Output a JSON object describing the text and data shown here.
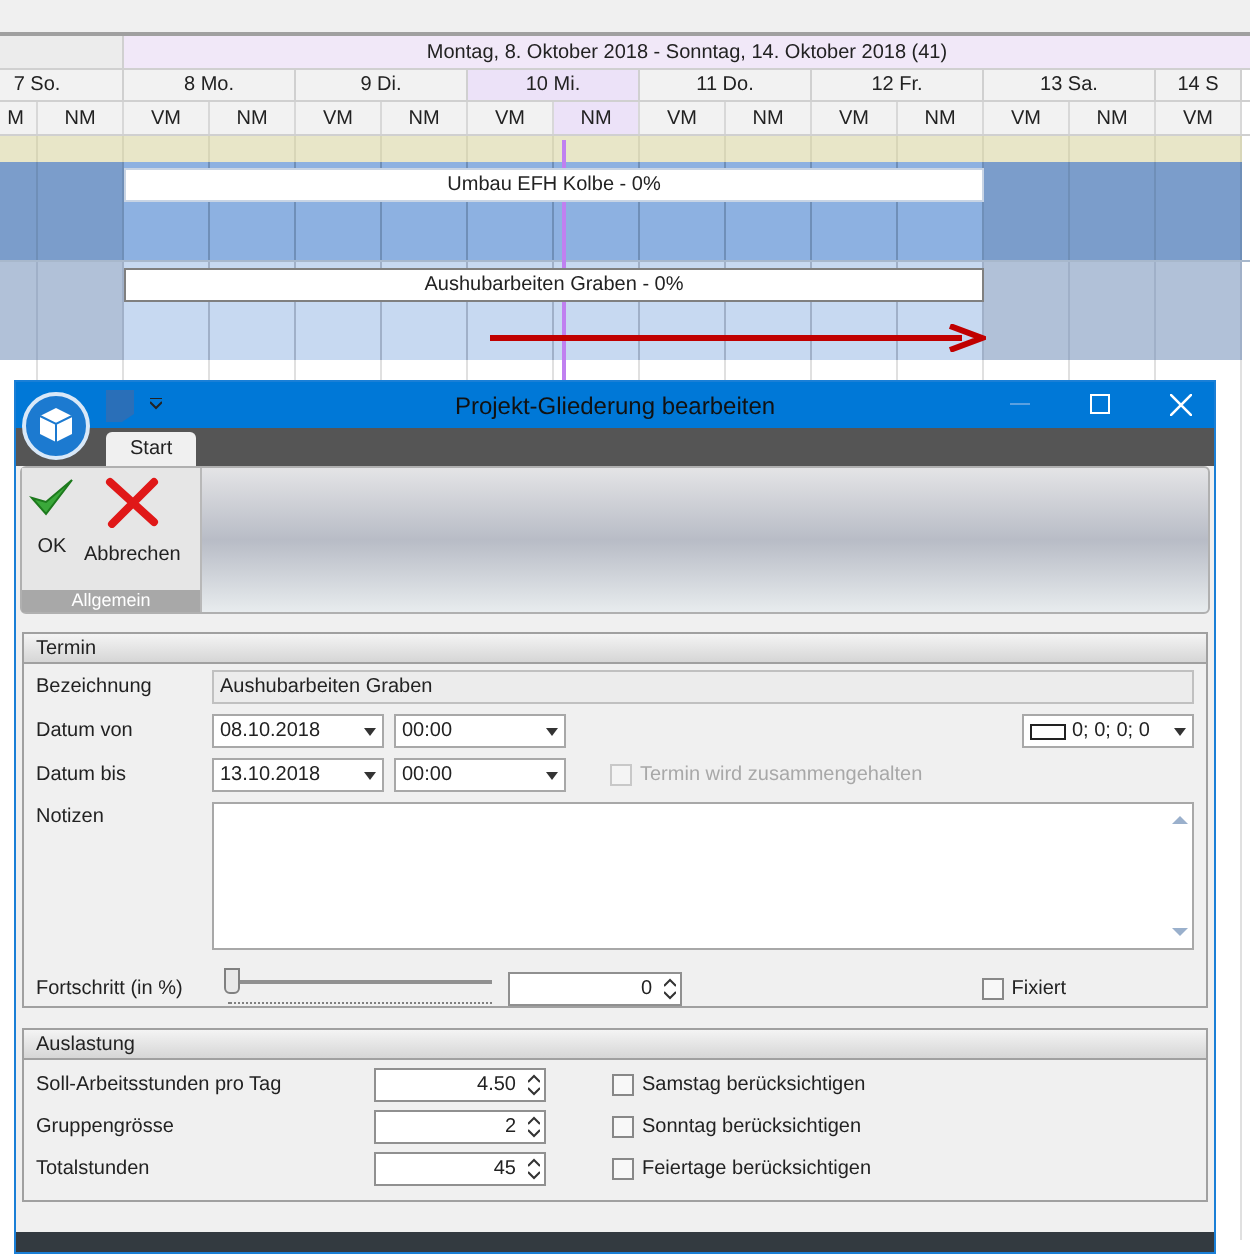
{
  "gantt": {
    "week_header": "Montag, 8. Oktober 2018 - Sonntag, 14. Oktober 2018 (41)",
    "days": [
      {
        "label": "7 So.",
        "weekend": true,
        "selected": false,
        "halves": [
          {
            "label": "M",
            "selected": false
          },
          {
            "label": "NM",
            "selected": false
          }
        ]
      },
      {
        "label": "8 Mo.",
        "weekend": false,
        "selected": false,
        "halves": [
          {
            "label": "VM",
            "selected": false
          },
          {
            "label": "NM",
            "selected": false
          }
        ]
      },
      {
        "label": "9 Di.",
        "weekend": false,
        "selected": false,
        "halves": [
          {
            "label": "VM",
            "selected": false
          },
          {
            "label": "NM",
            "selected": false
          }
        ]
      },
      {
        "label": "10 Mi.",
        "weekend": false,
        "selected": true,
        "halves": [
          {
            "label": "VM",
            "selected": false
          },
          {
            "label": "NM",
            "selected": true
          }
        ]
      },
      {
        "label": "11 Do.",
        "weekend": false,
        "selected": false,
        "halves": [
          {
            "label": "VM",
            "selected": false
          },
          {
            "label": "NM",
            "selected": false
          }
        ]
      },
      {
        "label": "12 Fr.",
        "weekend": false,
        "selected": false,
        "halves": [
          {
            "label": "VM",
            "selected": false
          },
          {
            "label": "NM",
            "selected": false
          }
        ]
      },
      {
        "label": "13 Sa.",
        "weekend": true,
        "selected": false,
        "halves": [
          {
            "label": "VM",
            "selected": false
          },
          {
            "label": "NM",
            "selected": false
          }
        ]
      },
      {
        "label": "14 S",
        "weekend": true,
        "selected": false,
        "halves": [
          {
            "label": "VM",
            "selected": false
          }
        ]
      }
    ],
    "tasks": [
      {
        "label": "Umbau EFH Kolbe - 0%",
        "selected": false
      },
      {
        "label": "Aushubarbeiten Graben - 0%",
        "selected": true
      }
    ]
  },
  "dialog": {
    "title": "Projekt-Gliederung bearbeiten",
    "tabs": [
      {
        "label": "Start",
        "selected": true
      }
    ],
    "ribbon_group": {
      "title": "Allgemein",
      "buttons": [
        {
          "kind": "ok",
          "label": "OK"
        },
        {
          "kind": "cancel",
          "label": "Abbrechen"
        }
      ]
    },
    "termin": {
      "title": "Termin",
      "bezeichnung": {
        "label": "Bezeichnung",
        "value": "Aushubarbeiten Graben"
      },
      "datum_von": {
        "label": "Datum von",
        "date": "08.10.2018",
        "time": "00:00",
        "color_value": "0; 0; 0; 0"
      },
      "datum_bis": {
        "label": "Datum bis",
        "date": "13.10.2018",
        "time": "00:00",
        "keep_together": {
          "label": "Termin wird zusammengehalten",
          "checked": false,
          "disabled": true
        }
      },
      "notizen": {
        "label": "Notizen"
      },
      "fortschritt": {
        "label": "Fortschritt (in %)",
        "level": 0,
        "value": "0",
        "fixiert": {
          "label": "Fixiert",
          "checked": false,
          "disabled": false
        }
      }
    },
    "auslastung": {
      "title": "Auslastung",
      "rows": [
        {
          "label": "Soll-Arbeitsstunden pro Tag",
          "value": "4.50",
          "option": {
            "label": "Samstag berücksichtigen",
            "checked": false,
            "disabled": false
          }
        },
        {
          "label": "Gruppengrösse",
          "value": "2",
          "option": {
            "label": "Sonntag berücksichtigen",
            "checked": false,
            "disabled": false
          }
        },
        {
          "label": "Totalstunden",
          "value": "45",
          "option": {
            "label": "Feiertage berücksichtigen",
            "checked": false,
            "disabled": false
          }
        }
      ]
    }
  }
}
